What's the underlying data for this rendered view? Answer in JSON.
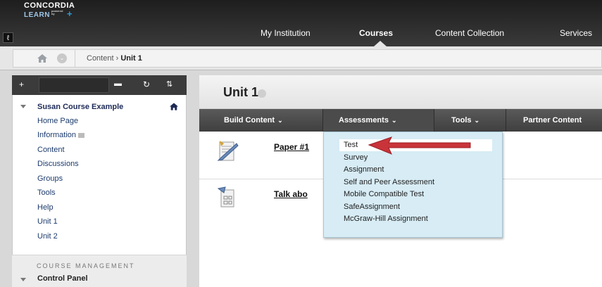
{
  "header": {
    "logo_line1": "CONCORDIA",
    "logo_line2": "LEARN",
    "logo_powered": "powered by Blackboard",
    "nav": [
      "My Institution",
      "Courses",
      "Content Collection",
      "Services"
    ],
    "active_nav": "Courses"
  },
  "breadcrumb": {
    "parent": "Content",
    "separator": "›",
    "current": "Unit 1"
  },
  "sidebar": {
    "course_title": "Susan Course Example",
    "items": [
      "Home Page",
      "Information",
      "Content",
      "Discussions",
      "Groups",
      "Tools",
      "Help",
      "Unit 1",
      "Unit 2"
    ],
    "management_label": "COURSE MANAGEMENT",
    "control_panel": "Control Panel"
  },
  "content": {
    "page_title": "Unit 1",
    "actions": [
      "Build Content",
      "Assessments",
      "Tools",
      "Partner Content"
    ],
    "items": [
      {
        "title": "Paper #1",
        "icon": "assignment-icon"
      },
      {
        "title": "Talk abo",
        "icon": "survey-icon"
      }
    ]
  },
  "assessments_menu": {
    "items": [
      "Test",
      "Survey",
      "Assignment",
      "Self and Peer Assessment",
      "Mobile Compatible Test",
      "SafeAssignment",
      "McGraw-Hill Assignment"
    ],
    "highlighted": "Test"
  },
  "colors": {
    "topbar": "#2a2a2a",
    "dropdown_bg": "#d7ecf5",
    "arrow": "#c8343a",
    "link": "#1d3b6d"
  }
}
